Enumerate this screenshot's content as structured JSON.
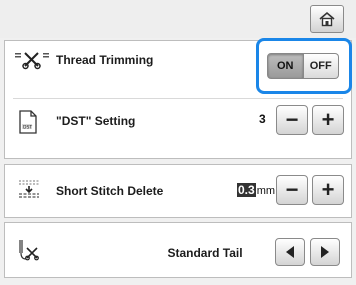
{
  "header": {
    "home_icon": "home-icon"
  },
  "settings": {
    "thread_trimming": {
      "label": "Thread Trimming",
      "icon": "thread-trim-icon",
      "on_label": "ON",
      "off_label": "OFF",
      "selected": "ON"
    },
    "dst_setting": {
      "label": "\"DST\" Setting",
      "icon": "dst-file-icon",
      "value": "3",
      "minus_label": "−",
      "plus_label": "+"
    },
    "short_stitch_delete": {
      "label": "Short Stitch Delete",
      "icon": "short-stitch-icon",
      "value": "0.3",
      "unit": "mm",
      "minus_label": "−",
      "plus_label": "+"
    },
    "tail": {
      "icon": "thread-tail-icon",
      "value": "Standard Tail",
      "left_icon": "arrow-left-icon",
      "right_icon": "arrow-right-icon"
    }
  },
  "colors": {
    "focus_outline": "#1a86e8"
  }
}
